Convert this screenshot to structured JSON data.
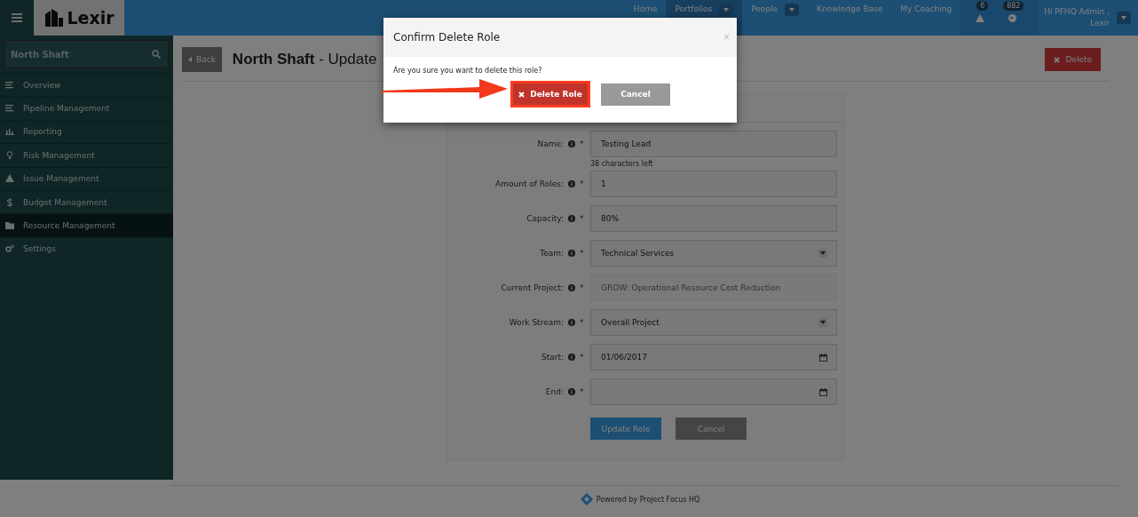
{
  "header": {
    "logo": "Lexir",
    "nav": [
      {
        "label": "Home",
        "selected": false,
        "dropdown": false
      },
      {
        "label": "Portfolios",
        "selected": true,
        "dropdown": true
      },
      {
        "label": "People",
        "selected": false,
        "dropdown": true
      },
      {
        "label": "Knowledge Base",
        "selected": false,
        "dropdown": false
      },
      {
        "label": "My Coaching",
        "selected": false,
        "dropdown": false
      }
    ],
    "alerts": [
      {
        "kind": "warning",
        "count": "6"
      },
      {
        "kind": "globe",
        "count": "882"
      }
    ],
    "user": {
      "greeting": "Hi PFHQ Admin ,",
      "org": "Lexir"
    }
  },
  "sidebar": {
    "search": {
      "value": "North Shaft"
    },
    "items": [
      {
        "label": "Overview",
        "kind": "lines",
        "selected": false
      },
      {
        "label": "Pipeline Management",
        "kind": "lines",
        "selected": false
      },
      {
        "label": "Reporting",
        "kind": "chart",
        "selected": false
      },
      {
        "label": "Risk Management",
        "kind": "bulb",
        "selected": false
      },
      {
        "label": "Issue Management",
        "kind": "warning",
        "selected": false
      },
      {
        "label": "Budget Management",
        "kind": "dollar",
        "selected": false
      },
      {
        "label": "Resource Management",
        "kind": "folder",
        "selected": true
      },
      {
        "label": "Settings",
        "kind": "gears",
        "selected": false
      }
    ]
  },
  "page": {
    "back": "Back",
    "title": "**North Shaft** - Update",
    "delete": "Delete"
  },
  "form": {
    "fields": [
      {
        "label": "Name:",
        "kind": "text",
        "value": "Testing Lead",
        "hint": "38 characters left",
        "disabled": false
      },
      {
        "label": "Amount of Roles:",
        "kind": "text",
        "value": "1",
        "disabled": false
      },
      {
        "label": "Capacity:",
        "kind": "text",
        "value": "80%",
        "disabled": false
      },
      {
        "label": "Team:",
        "kind": "select",
        "value": "Technical Services",
        "disabled": false
      },
      {
        "label": "Current Project:",
        "kind": "text",
        "value": "GROW: Operational Resource Cost Reduction",
        "disabled": true
      },
      {
        "label": "Work Stream:",
        "kind": "select",
        "value": "Overall Project",
        "disabled": false
      },
      {
        "label": "Start:",
        "kind": "date",
        "value": "01/06/2017",
        "disabled": false
      },
      {
        "label": "End:",
        "kind": "date",
        "disabled": false
      }
    ],
    "required_mark": "*",
    "submit": "Update Role",
    "cancel": "Cancel"
  },
  "footer": {
    "text": "Powered by Project Focus HQ"
  },
  "modal": {
    "title": "Confirm Delete Role",
    "close": "×",
    "message": "Are you sure you want to delete this role?",
    "confirm": "Delete Role",
    "cancel": "Cancel",
    "highlighted": true
  }
}
